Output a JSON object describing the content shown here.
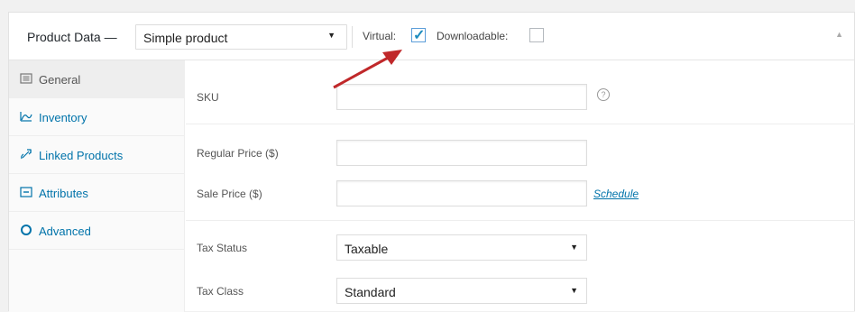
{
  "header": {
    "title": "Product Data —",
    "product_type": "Simple product",
    "virtual_label": "Virtual:",
    "virtual_checked": true,
    "downloadable_label": "Downloadable:",
    "downloadable_checked": false
  },
  "sidebar": {
    "items": [
      {
        "label": "General",
        "icon": "general-icon",
        "active": true
      },
      {
        "label": "Inventory",
        "icon": "inventory-icon",
        "active": false
      },
      {
        "label": "Linked Products",
        "icon": "link-icon",
        "active": false
      },
      {
        "label": "Attributes",
        "icon": "attributes-icon",
        "active": false
      },
      {
        "label": "Advanced",
        "icon": "gear-icon",
        "active": false
      }
    ]
  },
  "general": {
    "sku_label": "SKU",
    "sku_value": "",
    "regular_price_label": "Regular Price ($)",
    "regular_price_value": "",
    "sale_price_label": "Sale Price ($)",
    "sale_price_value": "",
    "schedule_link": "Schedule",
    "tax_status_label": "Tax Status",
    "tax_status_value": "Taxable",
    "tax_class_label": "Tax Class",
    "tax_class_value": "Standard"
  },
  "colors": {
    "link": "#0073aa",
    "checkbox_tick": "#1e8cbe",
    "annotation_arrow": "#c0282a"
  }
}
